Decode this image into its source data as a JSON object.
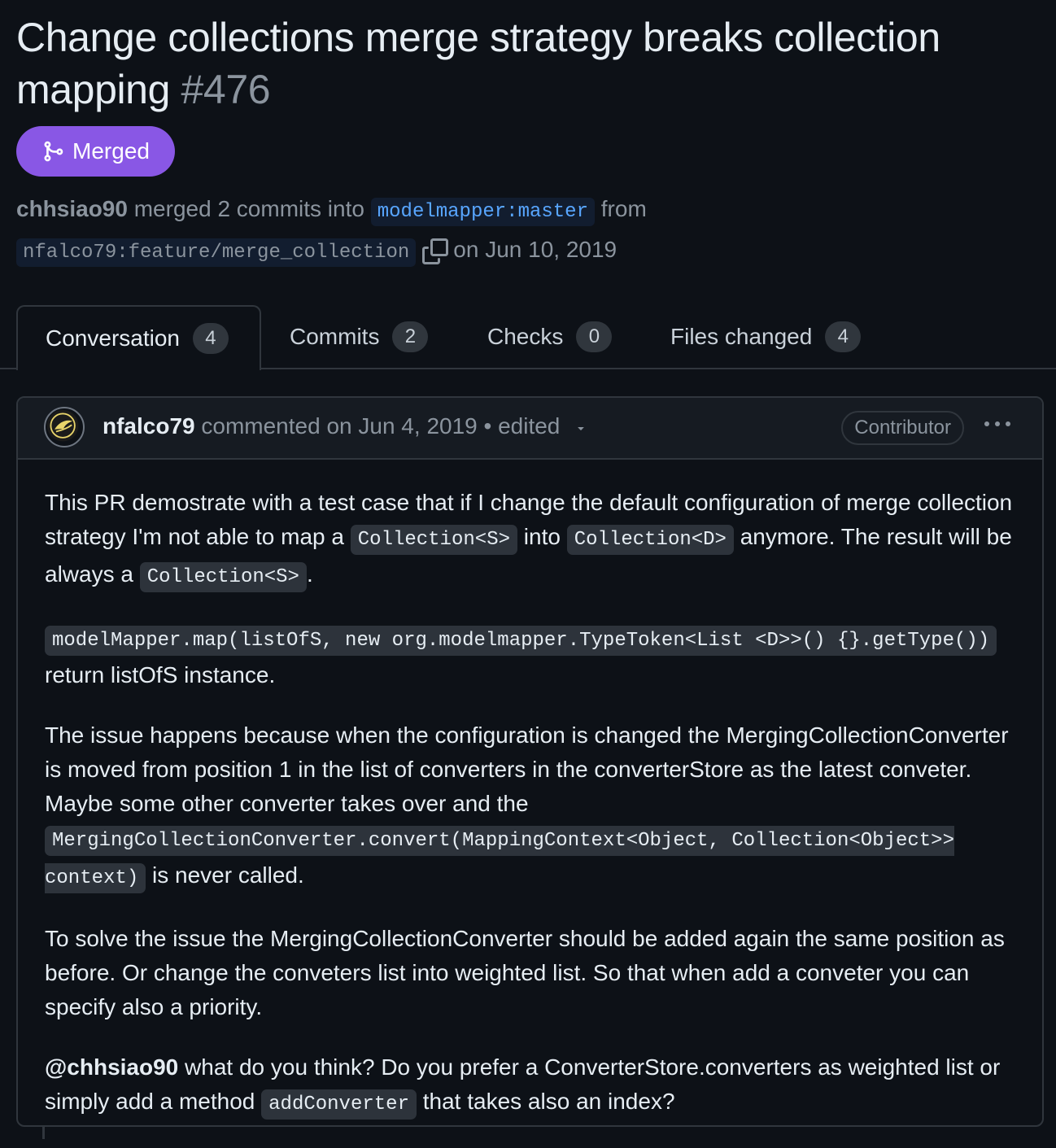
{
  "pr": {
    "title": "Change collections merge strategy breaks collection mapping",
    "number": "#476",
    "status": "Merged",
    "merger": "chhsiao90",
    "merged_text": "merged 2 commits into",
    "base_branch": "modelmapper:master",
    "from_text": "from",
    "head_branch": "nfalco79:feature/merge_collection",
    "date_text": "on Jun 10, 2019"
  },
  "tabs": [
    {
      "label": "Conversation",
      "count": "4"
    },
    {
      "label": "Commits",
      "count": "2"
    },
    {
      "label": "Checks",
      "count": "0"
    },
    {
      "label": "Files changed",
      "count": "4"
    }
  ],
  "comment": {
    "author": "nfalco79",
    "action": "commented on Jun 4, 2019 • edited",
    "role": "Contributor",
    "p1_a": "This PR demostrate with a test case that if I change the default configuration of merge collection strategy I'm not able to map a",
    "p1_code1": "Collection<S>",
    "p1_b": "into",
    "p1_code2": "Collection<D>",
    "p1_c": "anymore. The result will be always a",
    "p1_code3": "Collection<S>",
    "p1_d": ".",
    "p2_code": "modelMapper.map(listOfS, new org.modelmapper.TypeToken<List <D>>() {}.getType())",
    "p2_text": "return listOfS instance.",
    "p3_a": "The issue happens because when the configuration is changed the MergingCollectionConverter is moved from position 1 in the list of converters in the converterStore as the latest conveter. Maybe some other converter takes over and the",
    "p3_code": "MergingCollectionConverter.convert(MappingContext<Object, Collection<Object>> context)",
    "p3_b": "is never called.",
    "p4": "To solve the issue the MergingCollectionConverter should be added again the same position as before. Or change the conveters list into weighted list. So that when add a conveter you can specify also a priority.",
    "p5_mention": "@chhsiao90",
    "p5_a": "what do you think? Do you prefer a ConverterStore.converters as weighted list or simply add a method",
    "p5_code": "addConverter",
    "p5_b": "that takes also an index?"
  },
  "colors": {
    "background": "#0d1117",
    "merged_purple": "#8957e5",
    "link_blue": "#58a6ff",
    "border": "#30363d"
  },
  "icons": [
    "git-merge-icon",
    "copy-icon",
    "caret-down-icon",
    "kebab-icon",
    "avatar"
  ]
}
